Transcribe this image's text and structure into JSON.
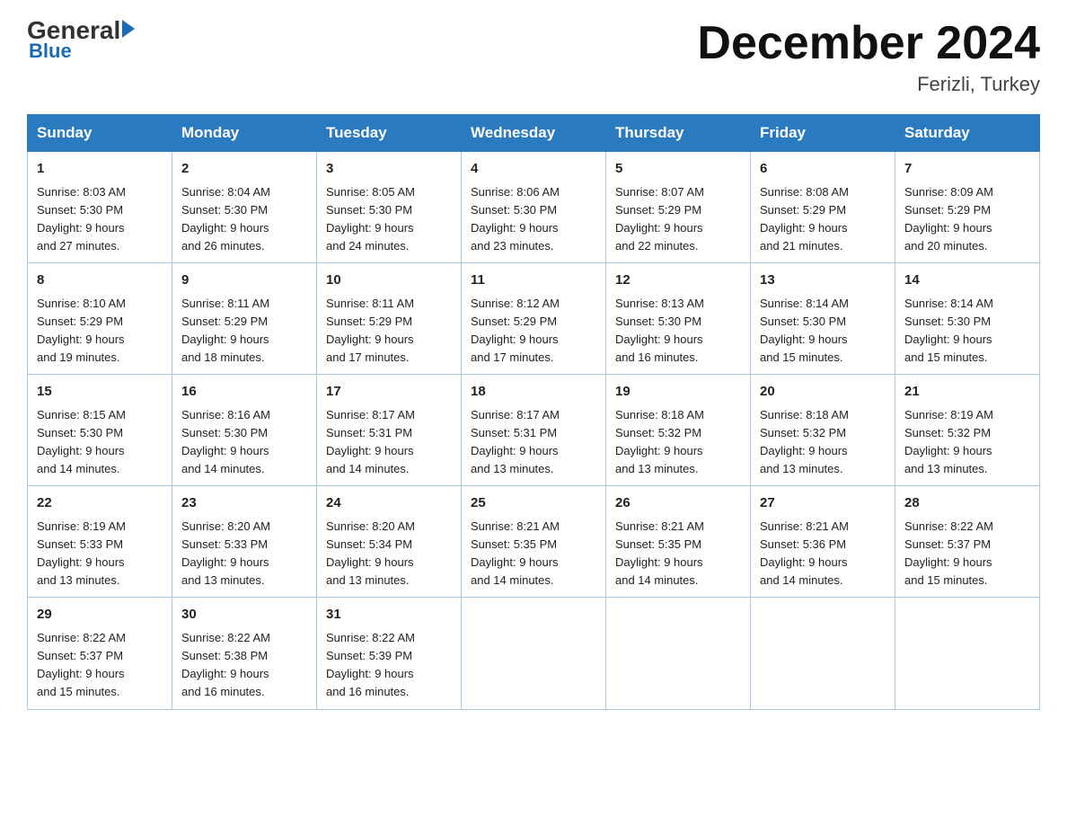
{
  "header": {
    "logo_general": "General",
    "logo_blue": "Blue",
    "month_title": "December 2024",
    "location": "Ferizli, Turkey"
  },
  "columns": [
    "Sunday",
    "Monday",
    "Tuesday",
    "Wednesday",
    "Thursday",
    "Friday",
    "Saturday"
  ],
  "weeks": [
    [
      {
        "day": "1",
        "info": "Sunrise: 8:03 AM\nSunset: 5:30 PM\nDaylight: 9 hours\nand 27 minutes."
      },
      {
        "day": "2",
        "info": "Sunrise: 8:04 AM\nSunset: 5:30 PM\nDaylight: 9 hours\nand 26 minutes."
      },
      {
        "day": "3",
        "info": "Sunrise: 8:05 AM\nSunset: 5:30 PM\nDaylight: 9 hours\nand 24 minutes."
      },
      {
        "day": "4",
        "info": "Sunrise: 8:06 AM\nSunset: 5:30 PM\nDaylight: 9 hours\nand 23 minutes."
      },
      {
        "day": "5",
        "info": "Sunrise: 8:07 AM\nSunset: 5:29 PM\nDaylight: 9 hours\nand 22 minutes."
      },
      {
        "day": "6",
        "info": "Sunrise: 8:08 AM\nSunset: 5:29 PM\nDaylight: 9 hours\nand 21 minutes."
      },
      {
        "day": "7",
        "info": "Sunrise: 8:09 AM\nSunset: 5:29 PM\nDaylight: 9 hours\nand 20 minutes."
      }
    ],
    [
      {
        "day": "8",
        "info": "Sunrise: 8:10 AM\nSunset: 5:29 PM\nDaylight: 9 hours\nand 19 minutes."
      },
      {
        "day": "9",
        "info": "Sunrise: 8:11 AM\nSunset: 5:29 PM\nDaylight: 9 hours\nand 18 minutes."
      },
      {
        "day": "10",
        "info": "Sunrise: 8:11 AM\nSunset: 5:29 PM\nDaylight: 9 hours\nand 17 minutes."
      },
      {
        "day": "11",
        "info": "Sunrise: 8:12 AM\nSunset: 5:29 PM\nDaylight: 9 hours\nand 17 minutes."
      },
      {
        "day": "12",
        "info": "Sunrise: 8:13 AM\nSunset: 5:30 PM\nDaylight: 9 hours\nand 16 minutes."
      },
      {
        "day": "13",
        "info": "Sunrise: 8:14 AM\nSunset: 5:30 PM\nDaylight: 9 hours\nand 15 minutes."
      },
      {
        "day": "14",
        "info": "Sunrise: 8:14 AM\nSunset: 5:30 PM\nDaylight: 9 hours\nand 15 minutes."
      }
    ],
    [
      {
        "day": "15",
        "info": "Sunrise: 8:15 AM\nSunset: 5:30 PM\nDaylight: 9 hours\nand 14 minutes."
      },
      {
        "day": "16",
        "info": "Sunrise: 8:16 AM\nSunset: 5:30 PM\nDaylight: 9 hours\nand 14 minutes."
      },
      {
        "day": "17",
        "info": "Sunrise: 8:17 AM\nSunset: 5:31 PM\nDaylight: 9 hours\nand 14 minutes."
      },
      {
        "day": "18",
        "info": "Sunrise: 8:17 AM\nSunset: 5:31 PM\nDaylight: 9 hours\nand 13 minutes."
      },
      {
        "day": "19",
        "info": "Sunrise: 8:18 AM\nSunset: 5:32 PM\nDaylight: 9 hours\nand 13 minutes."
      },
      {
        "day": "20",
        "info": "Sunrise: 8:18 AM\nSunset: 5:32 PM\nDaylight: 9 hours\nand 13 minutes."
      },
      {
        "day": "21",
        "info": "Sunrise: 8:19 AM\nSunset: 5:32 PM\nDaylight: 9 hours\nand 13 minutes."
      }
    ],
    [
      {
        "day": "22",
        "info": "Sunrise: 8:19 AM\nSunset: 5:33 PM\nDaylight: 9 hours\nand 13 minutes."
      },
      {
        "day": "23",
        "info": "Sunrise: 8:20 AM\nSunset: 5:33 PM\nDaylight: 9 hours\nand 13 minutes."
      },
      {
        "day": "24",
        "info": "Sunrise: 8:20 AM\nSunset: 5:34 PM\nDaylight: 9 hours\nand 13 minutes."
      },
      {
        "day": "25",
        "info": "Sunrise: 8:21 AM\nSunset: 5:35 PM\nDaylight: 9 hours\nand 14 minutes."
      },
      {
        "day": "26",
        "info": "Sunrise: 8:21 AM\nSunset: 5:35 PM\nDaylight: 9 hours\nand 14 minutes."
      },
      {
        "day": "27",
        "info": "Sunrise: 8:21 AM\nSunset: 5:36 PM\nDaylight: 9 hours\nand 14 minutes."
      },
      {
        "day": "28",
        "info": "Sunrise: 8:22 AM\nSunset: 5:37 PM\nDaylight: 9 hours\nand 15 minutes."
      }
    ],
    [
      {
        "day": "29",
        "info": "Sunrise: 8:22 AM\nSunset: 5:37 PM\nDaylight: 9 hours\nand 15 minutes."
      },
      {
        "day": "30",
        "info": "Sunrise: 8:22 AM\nSunset: 5:38 PM\nDaylight: 9 hours\nand 16 minutes."
      },
      {
        "day": "31",
        "info": "Sunrise: 8:22 AM\nSunset: 5:39 PM\nDaylight: 9 hours\nand 16 minutes."
      },
      {
        "day": "",
        "info": ""
      },
      {
        "day": "",
        "info": ""
      },
      {
        "day": "",
        "info": ""
      },
      {
        "day": "",
        "info": ""
      }
    ]
  ]
}
